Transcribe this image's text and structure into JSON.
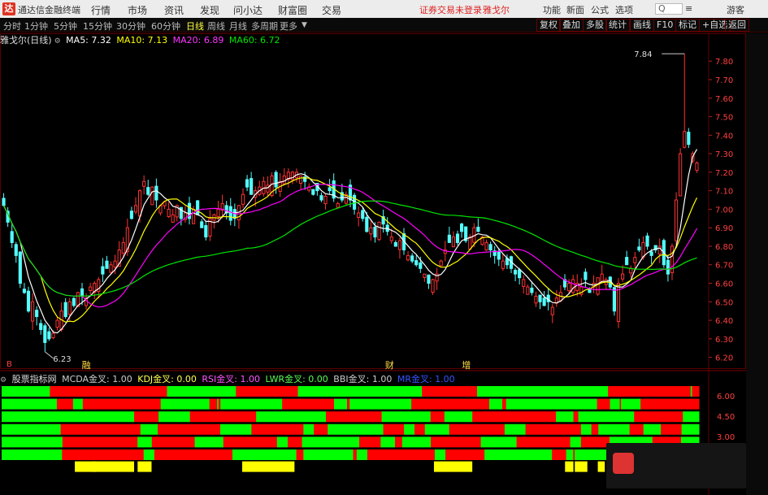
{
  "titlebar": {
    "app_title": "通达信金融终端",
    "menus": [
      "行情",
      "市场",
      "资讯",
      "发现",
      "问小达",
      "财富圈",
      "交易"
    ],
    "notice": "证券交易未登录",
    "stock_link": "雅戈尔",
    "tools": [
      "功能",
      "新面",
      "公式",
      "选项"
    ],
    "guest": "游客",
    "search_label": "Q"
  },
  "periods": [
    "分时",
    "1分钟",
    "5分钟",
    "15分钟",
    "30分钟",
    "60分钟",
    "日线",
    "周线",
    "月线",
    "多周期",
    "更多"
  ],
  "active_period": "日线",
  "right_buttons": [
    "复权",
    "叠加",
    "多股",
    "统计",
    "画线",
    "F10",
    "标记",
    "+自选",
    "返回"
  ],
  "info": {
    "name": "雅戈尔(日线)",
    "ma5": "MA5: 7.32",
    "ma10": "MA10: 7.13",
    "ma20": "MA20: 6.89",
    "ma60": "MA60: 6.72"
  },
  "colors": {
    "up": "#ff3232",
    "down": "#54ffff",
    "ma5": "#ffffff",
    "ma10": "#ffff00",
    "ma20": "#ff00ff",
    "ma60": "#00e600",
    "green_band": "#00ff00",
    "red_band": "#ff0000",
    "yellow_band": "#ffff00"
  },
  "price_axis": {
    "ticks": [
      "7.80",
      "7.70",
      "7.60",
      "7.50",
      "7.40",
      "7.30",
      "7.20",
      "7.10",
      "7.00",
      "6.90",
      "6.80",
      "6.70",
      "6.60",
      "6.50",
      "6.40",
      "6.30",
      "6.20"
    ],
    "min": 6.15,
    "max": 7.88
  },
  "annotations": {
    "high": "7.84",
    "low": "6.23",
    "events": [
      {
        "label": "融",
        "pos": 0.115
      },
      {
        "label": "财",
        "pos": 0.55
      },
      {
        "label": "增",
        "pos": 0.66
      }
    ],
    "marker": "B"
  },
  "subchart": {
    "title": "股票指标网",
    "items": [
      {
        "text": "MCDA金叉: 1.00",
        "color": "#cccccc"
      },
      {
        "text": "KDJ金叉: 0.00",
        "color": "#ffff55"
      },
      {
        "text": "RSI金叉: 1.00",
        "color": "#ff55ff"
      },
      {
        "text": "LWR金叉: 0.00",
        "color": "#55ff55"
      },
      {
        "text": "BBI金叉: 1.00",
        "color": "#cccccc"
      },
      {
        "text": "MR金叉: 1.00",
        "color": "#3355ff"
      }
    ],
    "axis_ticks": [
      "6.00",
      "4.50",
      "3.00"
    ],
    "rows": [
      [
        [
          "G",
          0.07
        ],
        [
          "R",
          0.17
        ],
        [
          "G",
          0.1
        ],
        [
          "R",
          0.09
        ],
        [
          "G",
          0.18
        ],
        [
          "R",
          0.08
        ],
        [
          "G",
          0.19
        ],
        [
          "R",
          0.12
        ],
        [
          "G",
          0.002
        ],
        [
          "R",
          0.01
        ]
      ],
      [
        [
          "G",
          0.085
        ],
        [
          "R",
          0.025
        ],
        [
          "G",
          0.015
        ],
        [
          "R",
          0.12
        ],
        [
          "G",
          0.075
        ],
        [
          "R",
          0.012
        ],
        [
          "G",
          0.002
        ],
        [
          "R",
          0.003
        ],
        [
          "G",
          0.095
        ],
        [
          "R",
          0.08
        ],
        [
          "G",
          0.02
        ],
        [
          "R",
          0.004
        ],
        [
          "G",
          0.095
        ],
        [
          "R",
          0.12
        ],
        [
          "G",
          0.02
        ],
        [
          "R",
          0.006
        ],
        [
          "G",
          0.14
        ],
        [
          "R",
          0.02
        ],
        [
          "G",
          0.015
        ],
        [
          "R",
          0.002
        ],
        [
          "G",
          0.03
        ],
        [
          "R",
          0.09
        ]
      ],
      [
        [
          "G",
          0.19
        ],
        [
          "R",
          0.035
        ],
        [
          "G",
          0.045
        ],
        [
          "R",
          0.095
        ],
        [
          "G",
          0.1
        ],
        [
          "R",
          0.08
        ],
        [
          "G",
          0.07
        ],
        [
          "R",
          0.02
        ],
        [
          "G",
          0.04
        ],
        [
          "R",
          0.12
        ],
        [
          "G",
          0.025
        ],
        [
          "R",
          0.007
        ],
        [
          "G",
          0.08
        ],
        [
          "R",
          0.07
        ],
        [
          "G",
          0.023
        ]
      ],
      [
        [
          "G",
          0.085
        ],
        [
          "R",
          0.115
        ],
        [
          "G",
          0.025
        ],
        [
          "R",
          0.09
        ],
        [
          "G",
          0.045
        ],
        [
          "R",
          0.075
        ],
        [
          "G",
          0.015
        ],
        [
          "R",
          0.02
        ],
        [
          "G",
          0.08
        ],
        [
          "R",
          0.03
        ],
        [
          "G",
          0.015
        ],
        [
          "R",
          0.015
        ],
        [
          "G",
          0.035
        ],
        [
          "R",
          0.08
        ],
        [
          "G",
          0.03
        ],
        [
          "R",
          0.08
        ],
        [
          "G",
          0.015
        ],
        [
          "R",
          0.01
        ],
        [
          "G",
          0.045
        ],
        [
          "R",
          0.02
        ],
        [
          "G",
          0.025
        ],
        [
          "R",
          0.03
        ],
        [
          "G",
          0.025
        ]
      ],
      [
        [
          "G",
          0.085
        ],
        [
          "R",
          0.105
        ],
        [
          "G",
          0.02
        ],
        [
          "R",
          0.06
        ],
        [
          "G",
          0.04
        ],
        [
          "R",
          0.075
        ],
        [
          "G",
          0.015
        ],
        [
          "R",
          0.02
        ],
        [
          "G",
          0.08
        ],
        [
          "R",
          0.03
        ],
        [
          "G",
          0.02
        ],
        [
          "R",
          0.01
        ],
        [
          "G",
          0.04
        ],
        [
          "R",
          0.07
        ],
        [
          "G",
          0.05
        ],
        [
          "R",
          0.075
        ],
        [
          "G",
          0.015
        ],
        [
          "R",
          0.04
        ],
        [
          "G",
          0.06
        ],
        [
          "R",
          0.04
        ],
        [
          "G",
          0.025
        ]
      ],
      [
        [
          "G",
          0.085
        ],
        [
          "R",
          0.115
        ],
        [
          "G",
          0.015
        ],
        [
          "R",
          0.11
        ],
        [
          "G",
          0.09
        ],
        [
          "R",
          0.01
        ],
        [
          "G",
          0.07
        ],
        [
          "R",
          0.005
        ],
        [
          "G",
          0.015
        ],
        [
          "R",
          0.095
        ],
        [
          "G",
          0.015
        ],
        [
          "R",
          0.055
        ],
        [
          "G",
          0.095
        ],
        [
          "R",
          0.02
        ],
        [
          "G",
          0.01
        ],
        [
          "R",
          0.002
        ],
        [
          "G",
          0.06
        ],
        [
          "R",
          0.105
        ],
        [
          "G",
          0.01
        ]
      ]
    ],
    "yellow": [
      [
        0.105,
        0.03
      ],
      [
        0.13,
        0.06
      ],
      [
        0.195,
        0.02
      ],
      [
        0.345,
        0.075
      ],
      [
        0.62,
        0.055
      ],
      [
        0.808,
        0.012
      ],
      [
        0.822,
        0.018
      ],
      [
        0.855,
        0.01
      ]
    ]
  },
  "chart_data": {
    "type": "candlestick",
    "series_name": "雅戈尔 日线",
    "ma_names": [
      "MA5",
      "MA10",
      "MA20",
      "MA60"
    ],
    "closes": [
      7.02,
      6.93,
      6.82,
      6.75,
      6.6,
      6.55,
      6.45,
      6.5,
      6.42,
      6.35,
      6.28,
      6.3,
      6.33,
      6.4,
      6.45,
      6.42,
      6.5,
      6.48,
      6.55,
      6.53,
      6.52,
      6.58,
      6.6,
      6.62,
      6.65,
      6.68,
      6.7,
      6.72,
      6.78,
      6.82,
      6.9,
      6.95,
      7.02,
      7.1,
      7.15,
      7.08,
      7.12,
      7.05,
      7.02,
      7.04,
      7.0,
      6.97,
      7.02,
      6.95,
      6.98,
      6.95,
      7.0,
      6.97,
      6.9,
      6.85,
      6.95,
      6.97,
      7.0,
      7.03,
      6.98,
      6.94,
      6.95,
      7.02,
      7.08,
      7.12,
      7.08,
      7.1,
      7.12,
      7.15,
      7.13,
      7.18,
      7.12,
      7.15,
      7.18,
      7.2,
      7.2,
      7.2,
      7.18,
      7.15,
      7.12,
      7.08,
      7.1,
      7.05,
      7.07,
      7.1,
      7.06,
      7.03,
      7.05,
      7.08,
      7.05,
      7.0,
      6.98,
      6.95,
      6.88,
      6.9,
      6.85,
      6.93,
      6.92,
      6.88,
      6.85,
      6.8,
      6.83,
      6.78,
      6.75,
      6.72,
      6.7,
      6.68,
      6.65,
      6.6,
      6.62,
      6.65,
      6.72,
      6.78,
      6.82,
      6.85,
      6.82,
      6.88,
      6.83,
      6.85,
      6.9,
      6.88,
      6.85,
      6.82,
      6.78,
      6.75,
      6.73,
      6.72,
      6.7,
      6.68,
      6.65,
      6.63,
      6.62,
      6.58,
      6.55,
      6.53,
      6.5,
      6.48,
      6.5,
      6.47,
      6.52,
      6.55,
      6.58,
      6.6,
      6.62,
      6.6,
      6.58,
      6.62,
      6.55,
      6.6,
      6.63,
      6.65,
      6.62,
      6.58,
      6.45,
      6.6,
      6.65,
      6.7,
      6.68,
      6.74,
      6.78,
      6.82,
      6.8,
      6.75,
      6.78,
      6.8,
      6.7,
      6.65,
      6.8,
      7.05,
      7.3,
      7.42,
      7.35,
      7.3,
      7.25
    ]
  }
}
